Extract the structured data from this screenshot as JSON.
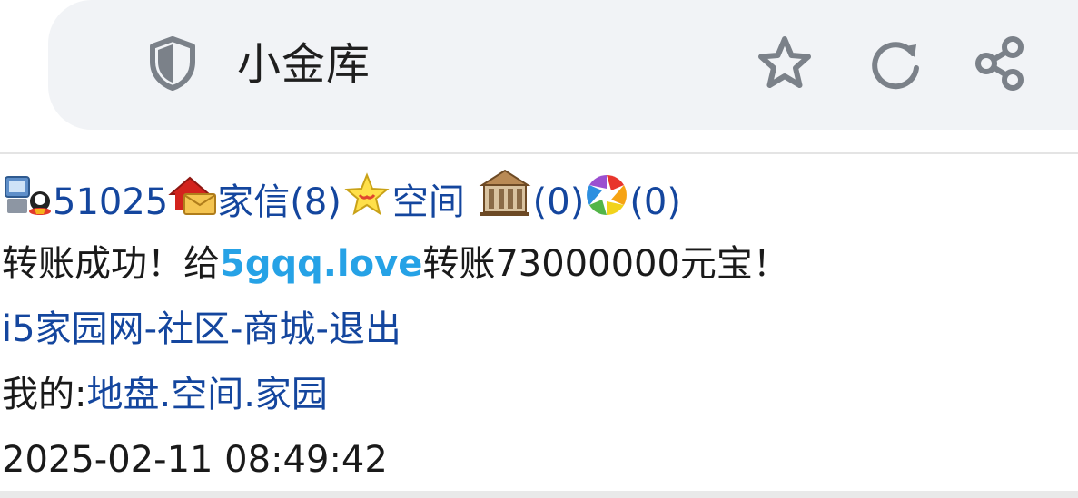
{
  "browser": {
    "page_title": "小金库",
    "icons": {
      "security": "shield-icon",
      "bookmark": "star-icon",
      "reload": "reload-icon",
      "share": "share-icon"
    }
  },
  "status_bar": {
    "user_id": "51025",
    "mail_label": "家信(8)",
    "space_label": "空间",
    "building_count": "(0)",
    "album_count": "(0)",
    "icons": {
      "user": "user-computer-icon",
      "mail": "house-mail-icon",
      "space": "star-badge-icon",
      "building": "building-icon",
      "album": "aperture-icon"
    }
  },
  "message": {
    "prefix": "转账成功！给",
    "recipient": "5gqq.love",
    "suffix": "转账73000000元宝！"
  },
  "nav": {
    "home": "i5家园网",
    "sep1": "-",
    "community": "社区",
    "sep2": "-",
    "mall": "商城",
    "sep3": "-",
    "logout": "退出"
  },
  "mine": {
    "label": "我的:",
    "land": "地盘",
    "dot1": ".",
    "space": "空间",
    "dot2": ".",
    "home": "家园"
  },
  "timestamp": "2025-02-11 08:49:42",
  "colors": {
    "link": "#14469e",
    "highlight": "#26a2e6",
    "urlbar_bg": "#f1f3f6",
    "icon_gray": "#7b8189"
  }
}
